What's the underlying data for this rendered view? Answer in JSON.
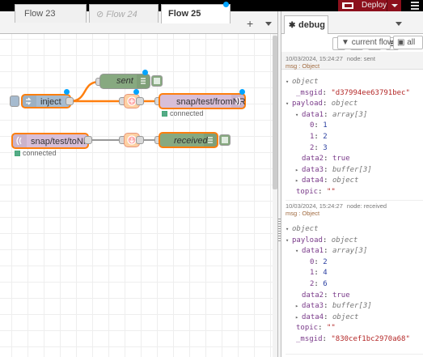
{
  "header": {
    "deploy_label": "Deploy"
  },
  "tabs": [
    {
      "label": "Flow 23"
    },
    {
      "label": "Flow 24",
      "disabled_icon": "⊘"
    },
    {
      "label": "Flow 25"
    }
  ],
  "tabbar": {
    "add_symbol": "+"
  },
  "nodes": {
    "sent": {
      "label": "sent"
    },
    "inject": {
      "label": "inject"
    },
    "mqtt_out": {
      "label": "snap/test/fromNR",
      "status": "connected"
    },
    "mqtt_in": {
      "label": "snap/test/toNR",
      "status": "connected"
    },
    "received": {
      "label": "received"
    }
  },
  "sidebar": {
    "tab_label": "debug",
    "filter_label": "current flow",
    "all_label": "all"
  },
  "messages": [
    {
      "meta_time": "10/03/2024, 15:24:27",
      "meta_node": "node: sent",
      "meta_topic": "msg : Object",
      "lines": [
        {
          "ar": "▾",
          "k": "",
          "sep": "",
          "t": "object",
          "v": ""
        },
        {
          "ar": "",
          "k": "_msgid",
          "sep": ": ",
          "t": "",
          "v": "\"d37994ee63791bec\""
        },
        {
          "ar": "▾",
          "k": "payload",
          "sep": ": ",
          "t": "object",
          "v": ""
        },
        {
          "ar": "▾",
          "k": "data1",
          "sep": ": ",
          "t": "array[3]",
          "v": ""
        },
        {
          "ar": "",
          "k": "0",
          "sep": ": ",
          "t": "",
          "v": "1"
        },
        {
          "ar": "",
          "k": "1",
          "sep": ": ",
          "t": "",
          "v": "2"
        },
        {
          "ar": "",
          "k": "2",
          "sep": ": ",
          "t": "",
          "v": "3"
        },
        {
          "ar": "",
          "k": "data2",
          "sep": ": ",
          "t": "",
          "v": "true"
        },
        {
          "ar": "▸",
          "k": "data3",
          "sep": ": ",
          "t": "buffer[3]",
          "v": ""
        },
        {
          "ar": "▸",
          "k": "data4",
          "sep": ": ",
          "t": "object",
          "v": ""
        },
        {
          "ar": "",
          "k": "topic",
          "sep": ": ",
          "t": "",
          "v": "\"\""
        }
      ]
    },
    {
      "meta_time": "10/03/2024, 15:24:27",
      "meta_node": "node: received",
      "meta_topic": "msg : Object",
      "lines": [
        {
          "ar": "▾",
          "k": "",
          "sep": "",
          "t": "object",
          "v": ""
        },
        {
          "ar": "▾",
          "k": "payload",
          "sep": ": ",
          "t": "object",
          "v": ""
        },
        {
          "ar": "▾",
          "k": "data1",
          "sep": ": ",
          "t": "array[3]",
          "v": ""
        },
        {
          "ar": "",
          "k": "0",
          "sep": ": ",
          "t": "",
          "v": "2"
        },
        {
          "ar": "",
          "k": "1",
          "sep": ": ",
          "t": "",
          "v": "4"
        },
        {
          "ar": "",
          "k": "2",
          "sep": ": ",
          "t": "",
          "v": "6"
        },
        {
          "ar": "",
          "k": "data2",
          "sep": ": ",
          "t": "",
          "v": "true"
        },
        {
          "ar": "▸",
          "k": "data3",
          "sep": ": ",
          "t": "buffer[3]",
          "v": ""
        },
        {
          "ar": "▸",
          "k": "data4",
          "sep": ": ",
          "t": "object",
          "v": ""
        },
        {
          "ar": "",
          "k": "topic",
          "sep": ": ",
          "t": "",
          "v": "\"\""
        },
        {
          "ar": "",
          "k": "_msgid",
          "sep": ": ",
          "t": "",
          "v": "\"830cef1bc2970a68\""
        }
      ]
    }
  ]
}
